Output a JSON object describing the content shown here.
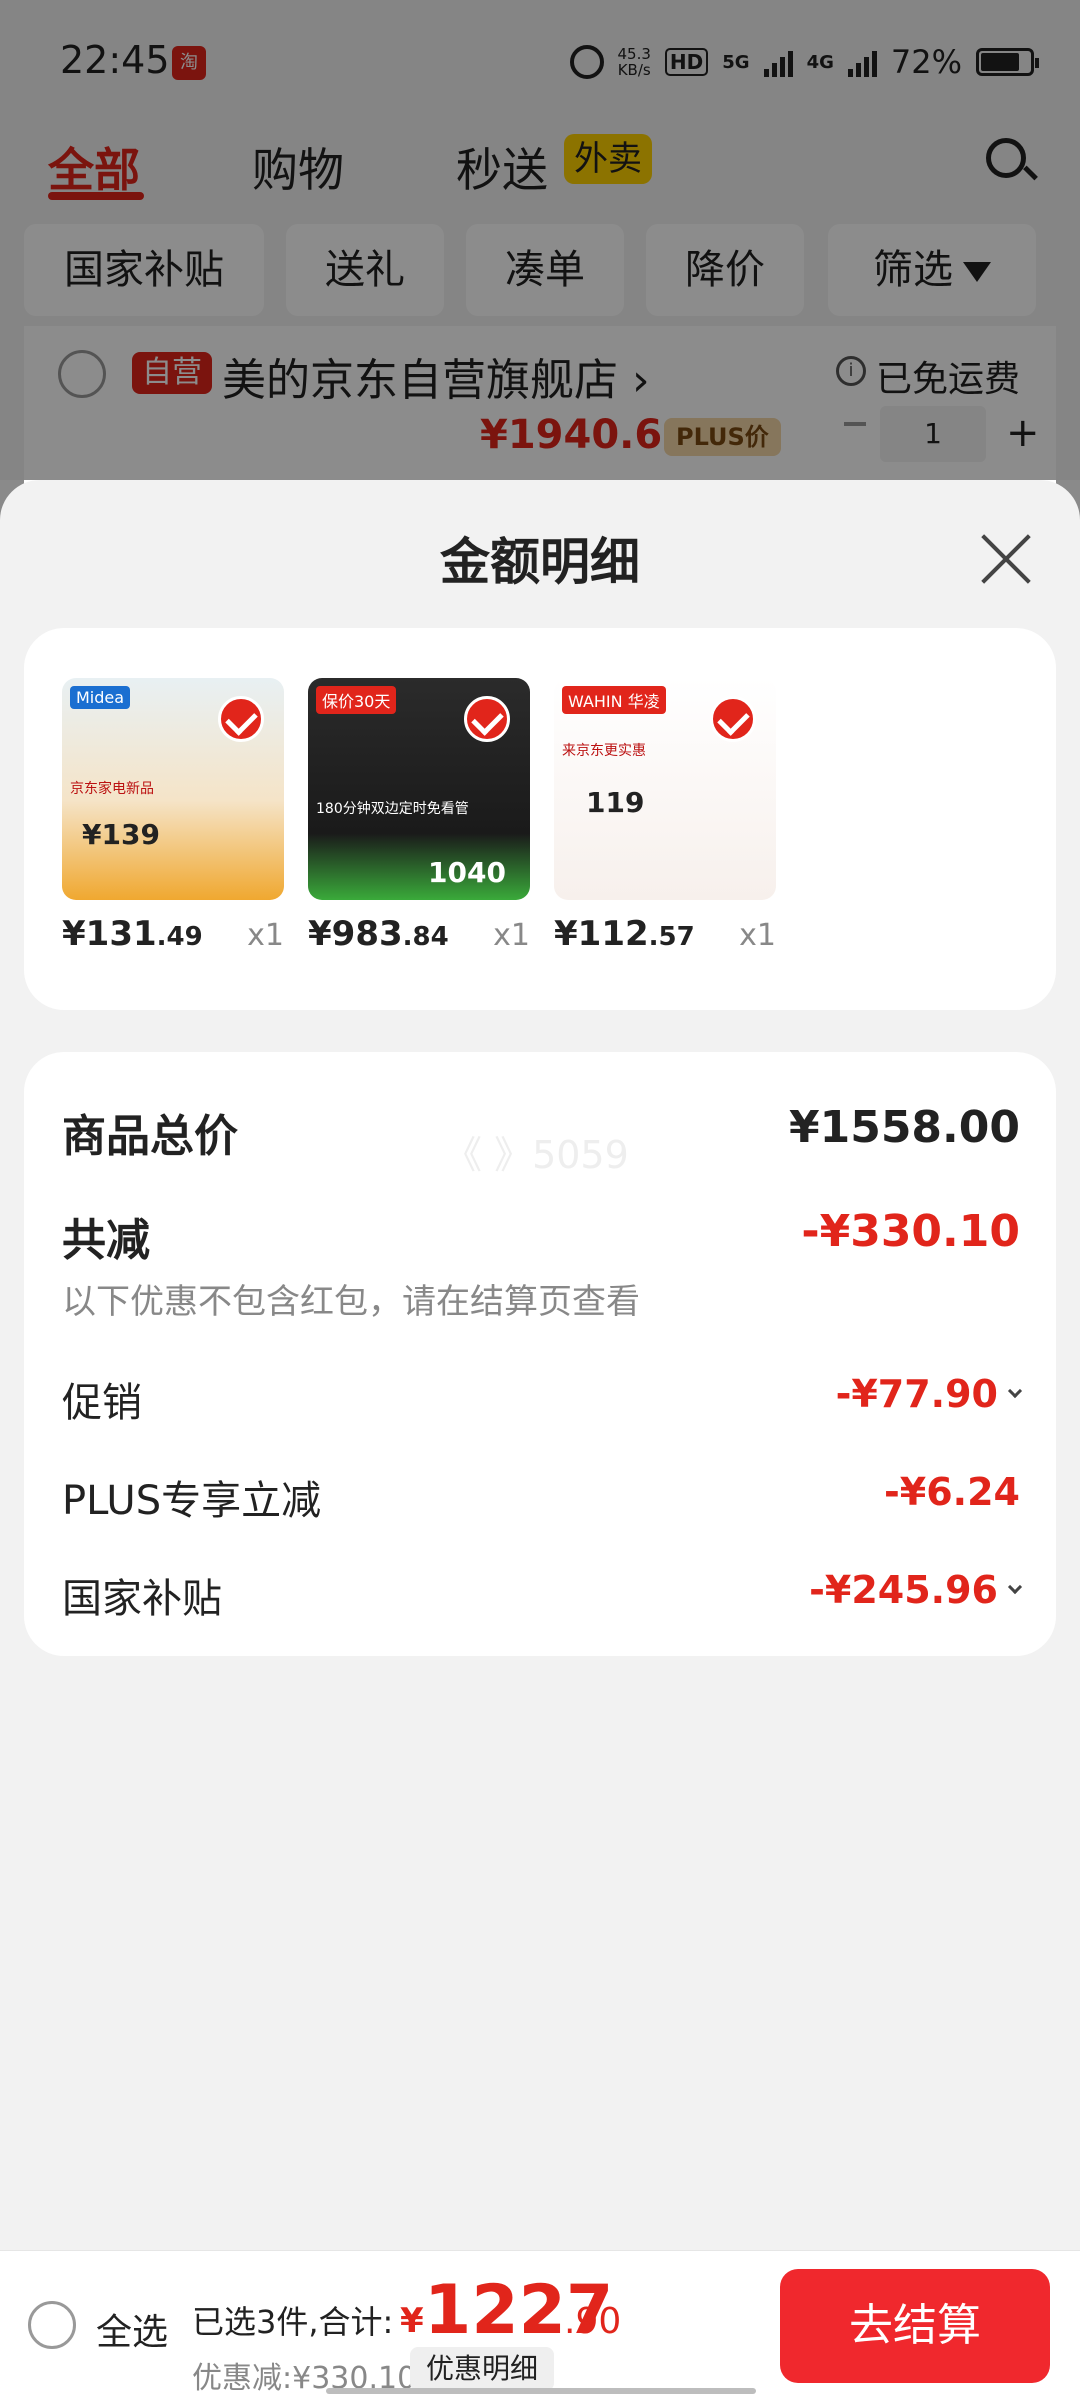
{
  "status_bar": {
    "time": "22:45",
    "net_speed_value": "45.3",
    "net_speed_unit": "KB/s",
    "hd": "HD",
    "net_5g": "5G",
    "net_4g": "4G",
    "battery": "72%",
    "app_icon_label": "淘"
  },
  "tabs": {
    "all": "全部",
    "shopping": "购物",
    "express": "秒送",
    "takeout_badge": "外卖"
  },
  "chips": [
    "国家补贴",
    "送礼",
    "凑单",
    "降价",
    "筛选"
  ],
  "store": {
    "self_badge": "自营",
    "name": "美的京东自营旗舰店 ›",
    "free_shipping": "已免运费",
    "info_icon": "i",
    "price": "¥1940.6",
    "plus_badge": "PLUS价",
    "qty": "1",
    "minus": "−",
    "plus": "+"
  },
  "sheet": {
    "title": "金额明细",
    "products": [
      {
        "price_int": "¥131",
        "price_dec": ".49",
        "qty": "x1",
        "img_tag": "Midea",
        "img_note": "京东家电新品",
        "img_price": "¥139"
      },
      {
        "price_int": "¥983",
        "price_dec": ".84",
        "qty": "x1",
        "img_tag": "保价30天",
        "img_note": "180分钟双边定时免看管",
        "img_price": "1040"
      },
      {
        "price_int": "¥112",
        "price_dec": ".57",
        "qty": "x1",
        "img_tag": "WAHIN 华凌",
        "img_note": "来京东更实惠",
        "img_price": "119"
      }
    ],
    "summary": {
      "total_label": "商品总价",
      "total_value": "¥1558.00",
      "discount_label": "共减",
      "discount_value": "-¥330.10",
      "discount_note": "以下优惠不包含红包，请在结算页查看",
      "promo_label": "促销",
      "promo_value": "-¥77.90",
      "plus_label": "PLUS专享立减",
      "plus_value": "-¥6.24",
      "subsidy_label": "国家补贴",
      "subsidy_value": "-¥245.96",
      "watermark": "《 》5059"
    }
  },
  "bottom_bar": {
    "select_all": "全选",
    "selected_text": "已选3件,合计:",
    "currency": "¥",
    "total_int": "1227",
    "total_dec": ".90",
    "discount_text": "优惠减:¥330.10",
    "detail_button": "优惠明细",
    "checkout": "去结算"
  },
  "colors": {
    "accent": "#e1251b",
    "checkout": "#f0282d",
    "badge_yellow": "#ffd100"
  }
}
